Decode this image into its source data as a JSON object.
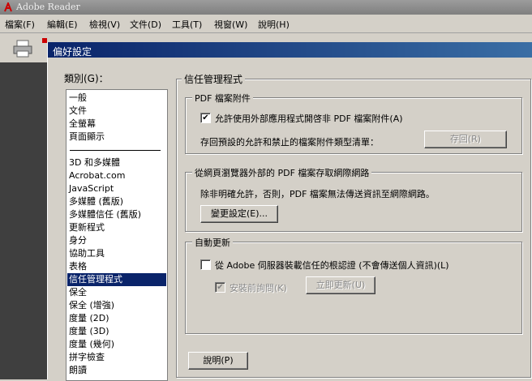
{
  "app": {
    "title": "Adobe Reader",
    "menu": [
      "檔案(F)",
      "編輯(E)",
      "檢視(V)",
      "文件(D)",
      "工具(T)",
      "視窗(W)",
      "說明(H)"
    ]
  },
  "dialog": {
    "title": "偏好設定",
    "category_label": "類別(G)：",
    "categories_top": [
      "一般",
      "文件",
      "全螢幕",
      "頁面顯示"
    ],
    "categories": [
      "3D 和多媒體",
      "Acrobat.com",
      "JavaScript",
      "多媒體 (舊版)",
      "多媒體信任 (舊版)",
      "更新程式",
      "身分",
      "協助工具",
      "表格",
      "信任管理程式",
      "保全",
      "保全 (增強)",
      "度量 (2D)",
      "度量 (3D)",
      "度量 (幾何)",
      "拼字檢查",
      "朗讀"
    ],
    "selected_category": "信任管理程式",
    "panel_title": "信任管理程式",
    "pdf_attach": {
      "group_title": "PDF 檔案附件",
      "allow_label": "允許使用外部應用程式開啓非 PDF 檔案附件(A)",
      "allow_checked": true,
      "restore_label": "存回預設的允許和禁止的檔案附件類型清單：",
      "restore_button": "存回(R)"
    },
    "internet": {
      "group_title": "從網頁瀏覽器外部的 PDF 檔案存取網際網路",
      "desc": "除非明確允許，否則，PDF 檔案無法傳送資訊至網際網路。",
      "change_button": "變更設定(E)..."
    },
    "auto_update": {
      "group_title": "自動更新",
      "load_label": "從 Adobe 伺服器裝載信任的根認證 (不會傳送個人資訊)(L)",
      "load_checked": false,
      "ask_label": "安裝前詢問(K)",
      "ask_checked": true,
      "update_button": "立即更新(U)"
    },
    "help_button": "說明(P)"
  }
}
